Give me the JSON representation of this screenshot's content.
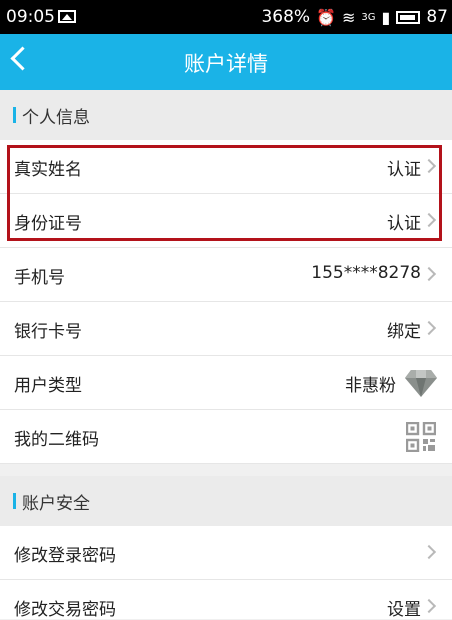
{
  "status_bar": {
    "time": "09:05",
    "speed": "368%",
    "network": "3G",
    "battery": "87"
  },
  "header": {
    "title": "账户详情"
  },
  "sections": [
    {
      "title": "个人信息",
      "rows": [
        {
          "label": "真实姓名",
          "value": "认证"
        },
        {
          "label": "身份证号",
          "value": "认证"
        },
        {
          "label": "手机号",
          "value": "155****8278"
        },
        {
          "label": "银行卡号",
          "value": "绑定"
        },
        {
          "label": "用户类型",
          "value": "非惠粉"
        },
        {
          "label": "我的二维码",
          "value": ""
        }
      ]
    },
    {
      "title": "账户安全",
      "rows": [
        {
          "label": "修改登录密码",
          "value": ""
        },
        {
          "label": "修改交易密码",
          "value": "设置"
        }
      ]
    }
  ],
  "colors": {
    "accent": "#1ab3e7",
    "highlight": "#b3121a"
  },
  "icons": {
    "user_type": "diamond-icon",
    "qr": "qr-code-icon"
  }
}
